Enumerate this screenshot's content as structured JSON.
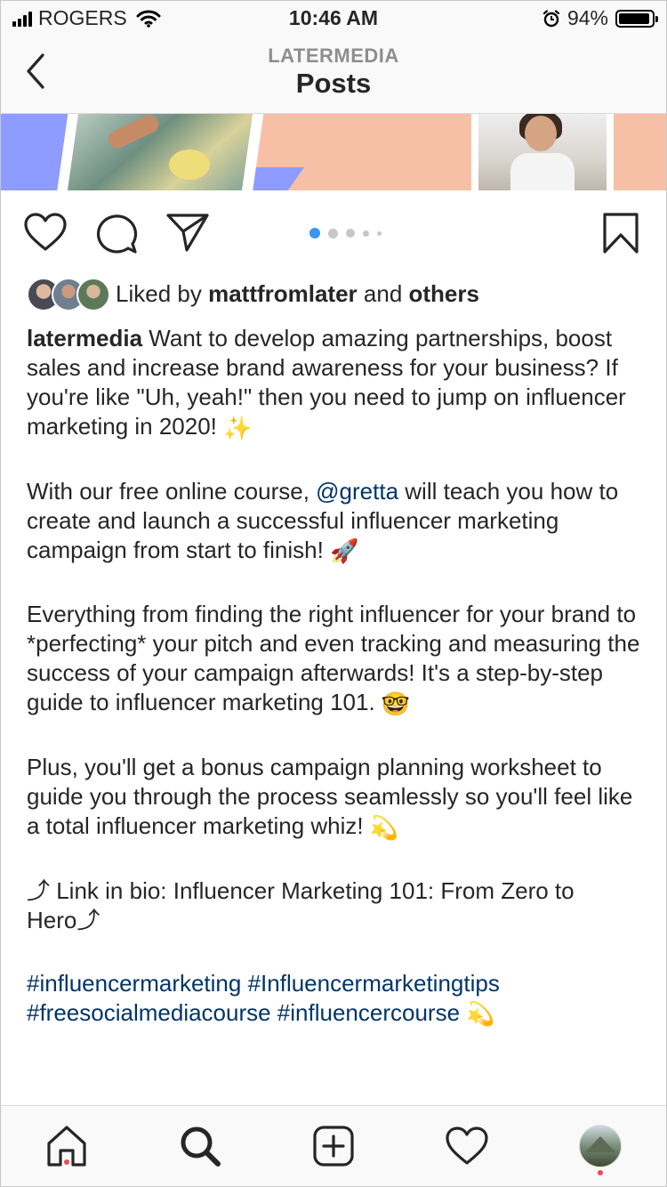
{
  "status_bar": {
    "carrier": "ROGERS",
    "time": "10:46 AM",
    "battery_percent": "94%",
    "battery_level": 0.94,
    "icons": [
      "signal-bars-icon",
      "wifi-icon",
      "alarm-icon",
      "battery-icon"
    ]
  },
  "header": {
    "account": "LATERMEDIA",
    "title": "Posts",
    "back_icon": "chevron-left-icon"
  },
  "post": {
    "carousel": {
      "count": 5,
      "active_index": 0
    },
    "likes": {
      "prefix": "Liked by ",
      "user": "mattfromlater",
      "middle": " and ",
      "others": "others"
    },
    "caption": {
      "username": "latermedia",
      "p1_text": " Want to develop amazing partnerships, boost sales and increase brand awareness for your business? If you're like \"Uh, yeah!\" then you need to jump on influencer marketing in 2020! ",
      "p1_emoji": "✨",
      "p2_before": "With our free online course, ",
      "p2_mention": "@gretta",
      "p2_after": " will teach you how to create and launch a successful influencer marketing campaign from start to finish! ",
      "p2_emoji": "🚀",
      "p3_text": "Everything from finding the right influencer for your brand to *perfecting* your pitch and even tracking and measuring the success of your campaign afterwards! It's a step-by-step guide to influencer marketing 101. ",
      "p3_emoji": "🤓",
      "p4_text": "Plus, you'll get a bonus campaign planning worksheet to guide you through the process seamlessly so you'll feel like a total influencer marketing whiz! ",
      "p4_emoji": "💫",
      "p5_text": "⤴ Link in bio: Influencer Marketing 101: From Zero to Hero⤴",
      "hashtags": "#influencermarketing #Influencermarketingtips #freesocialmediacourse #influencercourse ",
      "hashtags_emoji": "💫"
    }
  },
  "tabbar": {
    "items": [
      "home-icon",
      "search-icon",
      "new-post-icon",
      "activity-heart-icon",
      "profile-avatar"
    ]
  },
  "colors": {
    "link": "#003569",
    "active_dot": "#3897f0",
    "notification": "#ed4956",
    "bar_bg": "#f9f9f9"
  }
}
